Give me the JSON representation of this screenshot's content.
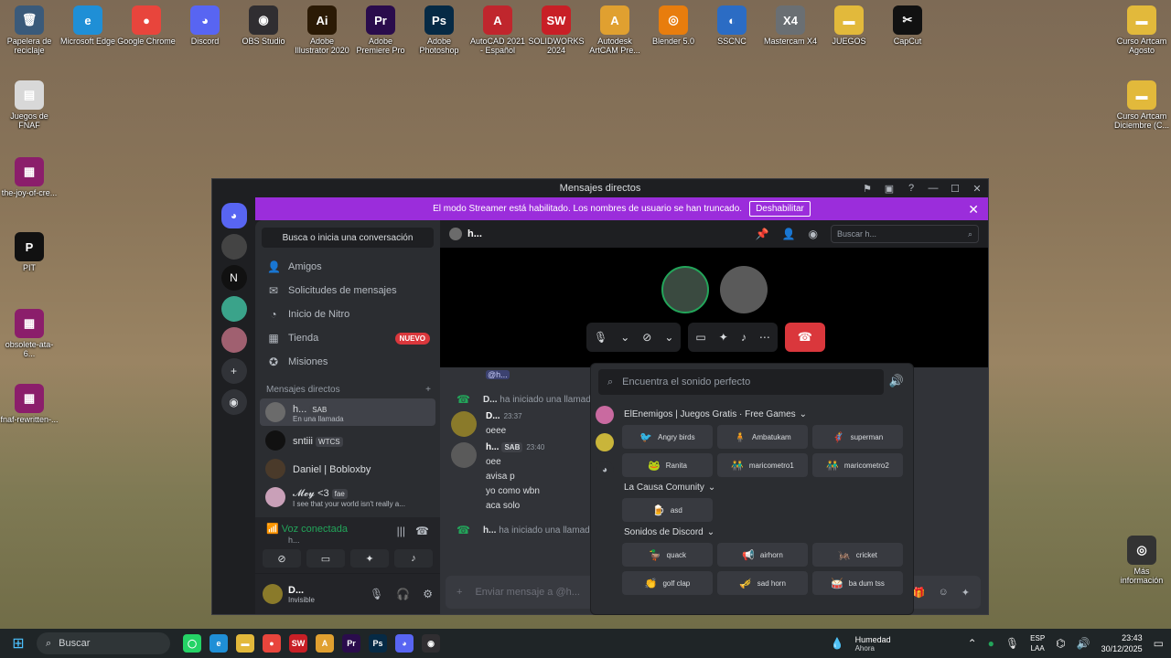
{
  "desktop_icons": [
    {
      "label": "Papelera de reciclaje",
      "glyph": "🗑",
      "color": "#3a5a7a"
    },
    {
      "label": "Microsoft Edge",
      "glyph": "e",
      "color": "#1f8fd6"
    },
    {
      "label": "Google Chrome",
      "glyph": "●",
      "color": "#e8453c"
    },
    {
      "label": "Discord",
      "glyph": "◕",
      "color": "#5865f2"
    },
    {
      "label": "OBS Studio",
      "glyph": "◉",
      "color": "#302e31"
    },
    {
      "label": "Adobe Illustrator 2020",
      "glyph": "Ai",
      "color": "#2b1a05"
    },
    {
      "label": "Adobe Premiere Pro 2020",
      "glyph": "Pr",
      "color": "#2a0c4c"
    },
    {
      "label": "Adobe Photoshop 2020",
      "glyph": "Ps",
      "color": "#062a45"
    },
    {
      "label": "AutoCAD 2021 - Español (Spani...",
      "glyph": "A",
      "color": "#c0262d"
    },
    {
      "label": "SOLIDWORKS 2024",
      "glyph": "SW",
      "color": "#c81f26"
    },
    {
      "label": "Autodesk ArtCAM Pre...",
      "glyph": "A",
      "color": "#e0a030"
    },
    {
      "label": "Blender 5.0",
      "glyph": "◎",
      "color": "#e87d0d"
    },
    {
      "label": "SSCNC",
      "glyph": "◐",
      "color": "#2b6cc4"
    },
    {
      "label": "Mastercam X4",
      "glyph": "X4",
      "color": "#6a6f73"
    },
    {
      "label": "JUEGOS",
      "glyph": "▬",
      "color": "#e2b93b"
    },
    {
      "label": "CapCut",
      "glyph": "✂",
      "color": "#111111"
    }
  ],
  "desktop_left_icons": [
    {
      "label": "Juegos de FNAF",
      "glyph": "▤",
      "color": "#d8d8d8"
    },
    {
      "label": "the-joy-of-cre...",
      "glyph": "▦",
      "color": "#8b1e6b"
    },
    {
      "label": "PIT",
      "glyph": "P",
      "color": "#111111"
    },
    {
      "label": "obsolete-ata-6...",
      "glyph": "▦",
      "color": "#8b1e6b"
    },
    {
      "label": "fnaf-rewritten-...",
      "glyph": "▦",
      "color": "#8b1e6b"
    }
  ],
  "desktop_right_icons": [
    {
      "label": "Curso Artcam Agosto",
      "glyph": "▬",
      "color": "#e2b93b"
    },
    {
      "label": "Curso Artcam Diciembre (C...",
      "glyph": "▬",
      "color": "#e2b93b"
    },
    {
      "label": "Más información sobre esta ima...",
      "glyph": "◎",
      "color": "#333333"
    }
  ],
  "window": {
    "title": "Mensajes directos",
    "banner_text": "El modo Streamer está habilitado. Los nombres de usuario se han truncado.",
    "banner_button": "Deshabilitar"
  },
  "sidebar": {
    "search_label": "Busca o inicia una conversación",
    "nav": [
      {
        "label": "Amigos",
        "icon": "friends-icon",
        "glyph": "👤"
      },
      {
        "label": "Solicitudes de mensajes",
        "icon": "mail-icon",
        "glyph": "✉"
      },
      {
        "label": "Inicio de Nitro",
        "icon": "nitro-icon",
        "glyph": "◔"
      },
      {
        "label": "Tienda",
        "icon": "shop-icon",
        "glyph": "▦",
        "badge": "NUEVO"
      },
      {
        "label": "Misiones",
        "icon": "missions-icon",
        "glyph": "✪"
      }
    ],
    "dm_header": "Mensajes directos",
    "dms": [
      {
        "name": "h...",
        "tag": "SAB",
        "sub": "En una llamada",
        "color": "#6b6b6b"
      },
      {
        "name": "sntiii",
        "tag": "WTCS",
        "sub": "",
        "color": "#111111"
      },
      {
        "name": "Daniel | Bobloxby",
        "tag": "",
        "sub": "",
        "color": "#4a3a2a"
      },
      {
        "name": "𝓜𝓮𝔂 <3",
        "tag": "fae",
        "sub": "I see that your world isn't really a...",
        "color": "#c9a0b8"
      }
    ],
    "voice": {
      "status": "Voz conectada",
      "channel": "h..."
    },
    "user": {
      "name": "D...",
      "status": "Invisible"
    }
  },
  "chat": {
    "header_name": "h...",
    "search_placeholder": "Buscar h...",
    "mention": "@h...",
    "messages": [
      {
        "type": "system",
        "author": "D...",
        "text": "ha iniciado una llamada"
      },
      {
        "type": "message",
        "author": "D...",
        "time": "23:37",
        "lines": [
          "oeee"
        ],
        "color": "#8a7a2a"
      },
      {
        "type": "message",
        "author": "h...",
        "tag": "SAB",
        "time": "23:40",
        "lines": [
          "oee",
          "avisa p",
          "yo como wbn",
          "aca solo"
        ],
        "color": "#5a5a5a"
      },
      {
        "type": "system",
        "author": "h...",
        "text": "ha iniciado una llamada"
      }
    ],
    "composer_placeholder": "Enviar mensaje a @h..."
  },
  "soundboard": {
    "search_placeholder": "Encuentra el sonido perfecto",
    "sections": [
      {
        "title": "ElEnemigos | Juegos Gratis · Free Games",
        "sounds": [
          {
            "label": "Angry birds",
            "emoji": "🐦"
          },
          {
            "label": "Ambatukam",
            "emoji": "🧍"
          },
          {
            "label": "superman",
            "emoji": "🦸"
          },
          {
            "label": "Ranita",
            "emoji": "🐸"
          },
          {
            "label": "maricometro1",
            "emoji": "👬"
          },
          {
            "label": "maricometro2",
            "emoji": "👬"
          }
        ]
      },
      {
        "title": "La Causa Comunity",
        "sounds": [
          {
            "label": "asd",
            "emoji": "🍺"
          }
        ]
      },
      {
        "title": "Sonidos de Discord",
        "sounds": [
          {
            "label": "quack",
            "emoji": "🦆"
          },
          {
            "label": "airhorn",
            "emoji": "📢"
          },
          {
            "label": "cricket",
            "emoji": "🦗"
          },
          {
            "label": "golf clap",
            "emoji": "👏"
          },
          {
            "label": "sad horn",
            "emoji": "🎺"
          },
          {
            "label": "ba dum tss",
            "emoji": "🥁"
          }
        ]
      }
    ]
  },
  "taskbar": {
    "search_label": "Buscar",
    "weather_title": "Humedad",
    "weather_sub": "Ahora",
    "lang_top": "ESP",
    "lang_bottom": "LAA",
    "time": "23:43",
    "date": "30/12/2025",
    "apps": [
      {
        "name": "whatsapp",
        "glyph": "◯",
        "color": "#25d366"
      },
      {
        "name": "edge",
        "glyph": "e",
        "color": "#1f8fd6"
      },
      {
        "name": "files",
        "glyph": "▬",
        "color": "#e2b93b"
      },
      {
        "name": "chrome",
        "glyph": "●",
        "color": "#e8453c"
      },
      {
        "name": "solidworks",
        "glyph": "SW",
        "color": "#c81f26"
      },
      {
        "name": "artcam",
        "glyph": "A",
        "color": "#e0a030"
      },
      {
        "name": "premiere",
        "glyph": "Pr",
        "color": "#2a0c4c"
      },
      {
        "name": "photoshop",
        "glyph": "Ps",
        "color": "#062a45"
      },
      {
        "name": "discord",
        "glyph": "◕",
        "color": "#5865f2"
      },
      {
        "name": "obs",
        "glyph": "◉",
        "color": "#302e31"
      }
    ]
  }
}
